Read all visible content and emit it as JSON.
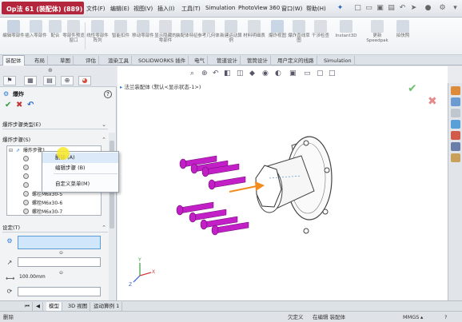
{
  "app": {
    "title": "Op法 61 (装配体) (889)",
    "menu": [
      "文件(F)",
      "编辑(E)",
      "视图(V)",
      "插入(I)",
      "工具(T)",
      "Simulation",
      "PhotoView 360",
      "窗口(W)",
      "帮助(H)"
    ]
  },
  "ribbon": {
    "buttons": [
      {
        "label": "编辑零部件"
      },
      {
        "label": "插入零部件"
      },
      {
        "label": "配合"
      },
      {
        "label": "零部件预览窗口"
      },
      {
        "label": "线性零部件阵列"
      },
      {
        "label": "智能扣件"
      },
      {
        "label": "移动零部件"
      },
      {
        "label": "显示隐藏的零部件"
      },
      {
        "label": "装配体特征"
      },
      {
        "label": "参考几何体"
      },
      {
        "label": "新建运动算例"
      },
      {
        "label": "材料明细表"
      },
      {
        "label": "爆炸视图"
      },
      {
        "label": "爆炸直线草图"
      },
      {
        "label": "干涉检查"
      },
      {
        "label": "Instant3D"
      },
      {
        "label": "更新Speedpak"
      },
      {
        "label": "拍快照"
      }
    ]
  },
  "tabs": [
    "装配体",
    "布局",
    "草图",
    "评估",
    "渲染工具",
    "SOLIDWORKS 插件",
    "电气",
    "管道设计",
    "管筒设计",
    "用户定义的线路",
    "Simulation"
  ],
  "active_tab": "装配体",
  "panel": {
    "title": "爆炸",
    "help": "?",
    "ok": "✔",
    "cancel": "✖",
    "sections": {
      "steps_type": "爆炸步骤类型(E)",
      "steps": "爆炸步骤(S)",
      "settings": "设定(T)"
    },
    "tree_root": "爆炸步骤1",
    "list_items": [
      "螺栓M6x30-5",
      "螺栓M6x30-6",
      "螺栓M6x30-7"
    ],
    "distance": "100.00mm"
  },
  "context_menu": {
    "items": [
      "删除 (A)",
      "编辑步骤 (B)",
      "自定义菜单(M)"
    ],
    "highlighted": 0
  },
  "graphics": {
    "breadcrumb": "法兰装配体 (默认<显示状态-1>)"
  },
  "bottom_tabs": [
    "模型",
    "3D 视图",
    "运动算例 1"
  ],
  "status": {
    "left": "删除",
    "under_defined": "欠定义",
    "editing": "在编辑 装配体",
    "unit": "MMGS"
  },
  "colors": {
    "accent": "#b3263c",
    "bolt": "#c21fc7",
    "arrow": "#f28c1e"
  }
}
